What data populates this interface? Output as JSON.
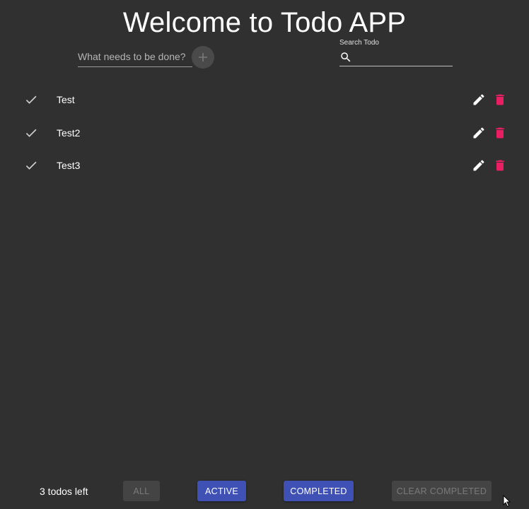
{
  "header": {
    "title": "Welcome to Todo APP"
  },
  "new_todo": {
    "placeholder": "What needs to be done?",
    "value": "",
    "add_icon": "plus-icon"
  },
  "search": {
    "label": "Search Todo",
    "value": "",
    "icon": "search-icon"
  },
  "todos": [
    {
      "text": "Test",
      "completed": false
    },
    {
      "text": "Test2",
      "completed": false
    },
    {
      "text": "Test3",
      "completed": false
    }
  ],
  "footer": {
    "count_text": "3 todos left",
    "filters": {
      "all": "ALL",
      "active": "ACTIVE",
      "completed": "COMPLETED"
    },
    "clear_completed": "CLEAR COMPLETED"
  },
  "colors": {
    "background": "#303030",
    "primary": "#3f51b5",
    "delete": "#e91e63",
    "disabled_bg": "#444444",
    "disabled_text": "#7a7a7a"
  }
}
